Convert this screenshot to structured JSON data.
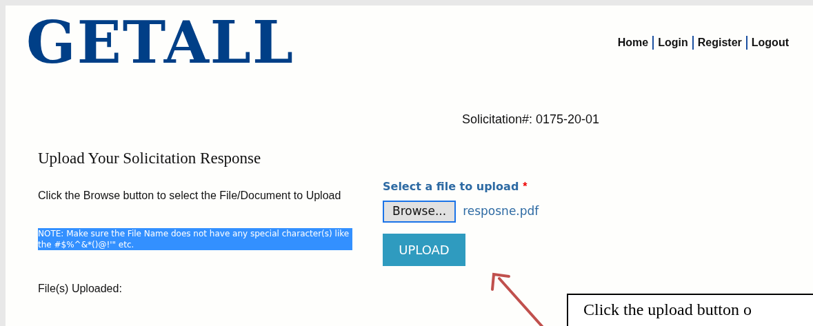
{
  "logo": {
    "text": "GETALL"
  },
  "nav": [
    {
      "label": "Home"
    },
    {
      "label": "Login"
    },
    {
      "label": "Register"
    },
    {
      "label": "Logout"
    }
  ],
  "solicitation": "Solicitation#: 0175-20-01",
  "heading": "Upload Your Solicitation Response",
  "instructions": "Click the Browse button to select the File/Document to Upload",
  "note": {
    "text": "NOTE: Make sure the File Name does not have any special character(s) like the #$%^&*()@!'\" etc.",
    "highlighted": true
  },
  "uploaded_label": "File(s) Uploaded:",
  "upload_form": {
    "label": "Select a file to upload",
    "required_mark": "*",
    "browse_button": "Browse...",
    "file_name": "resposne.pdf",
    "upload_button": "UPLOAD"
  },
  "callout": {
    "text": "Click the upload button o"
  }
}
